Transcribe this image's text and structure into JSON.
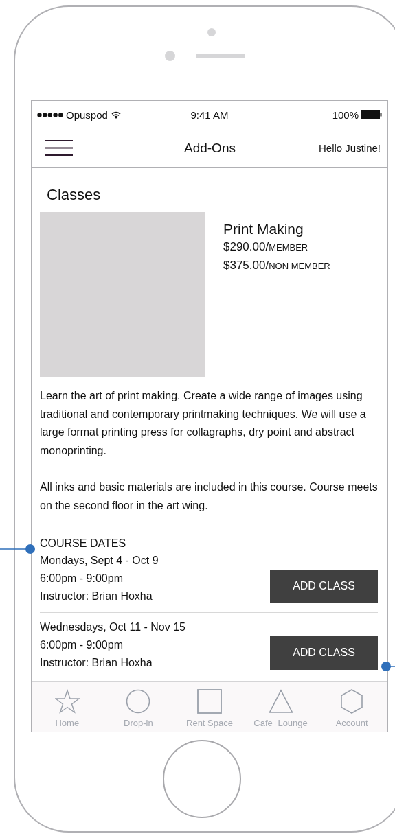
{
  "status_bar": {
    "carrier": "Opuspod",
    "time": "9:41 AM",
    "battery": "100%"
  },
  "header": {
    "title": "Add-Ons",
    "greeting": "Hello Justine!"
  },
  "section_title": "Classes",
  "course": {
    "title": "Print Making",
    "prices": [
      {
        "amount": "$290.00/",
        "unit": "MEMBER"
      },
      {
        "amount": "$375.00/",
        "unit": "NON MEMBER"
      }
    ],
    "description": [
      "Learn the art of print making. Create a wide range of images using traditional and contemporary printmaking techniques. We will use a large format printing press for collagraphs, dry point and abstract monoprinting.",
      "All inks and basic materials are included in this course. Course meets on the second floor in the art wing."
    ]
  },
  "dates_heading": "COURSE DATES",
  "sessions": [
    {
      "days": "Mondays, Sept 4 - Oct 9",
      "time": "6:00pm - 9:00pm",
      "instructor": "Instructor: Brian Hoxha",
      "button": "ADD CLASS"
    },
    {
      "days": "Wednesdays, Oct 11 - Nov 15",
      "time": "6:00pm - 9:00pm",
      "instructor": "Instructor: Brian Hoxha",
      "button": "ADD CLASS"
    }
  ],
  "tabs": [
    {
      "label": "Home",
      "kind": "star"
    },
    {
      "label": "Drop-in",
      "kind": "circle"
    },
    {
      "label": "Rent Space",
      "kind": "square"
    },
    {
      "label": "Cafe+Lounge",
      "kind": "triangle"
    },
    {
      "label": "Account",
      "kind": "hexagon"
    }
  ]
}
